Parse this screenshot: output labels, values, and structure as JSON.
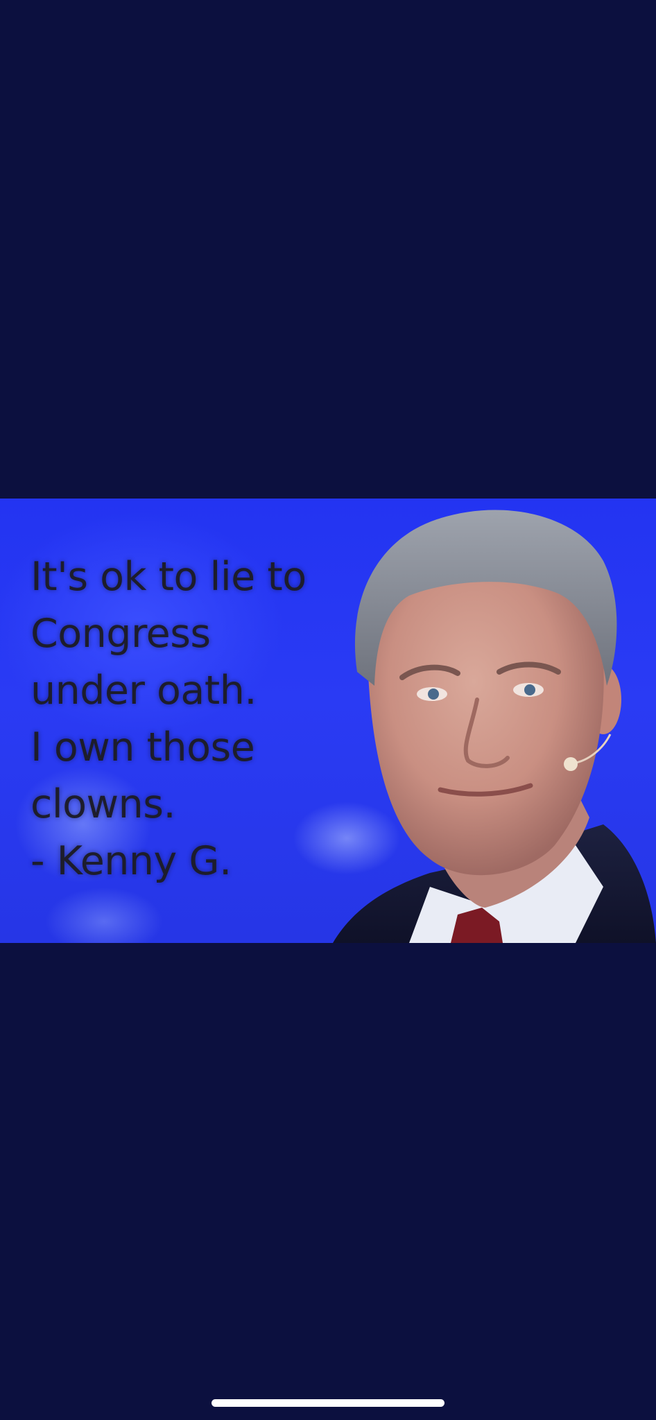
{
  "meme": {
    "quote_lines": [
      "It's ok to lie to",
      "Congress",
      "under oath.",
      "I own those",
      "clowns.",
      "- Kenny G."
    ]
  },
  "colors": {
    "viewer_background": "#0c103f",
    "meme_background": "#2a3bf4",
    "text": "#1d1d2c",
    "home_indicator": "#ffffff"
  }
}
